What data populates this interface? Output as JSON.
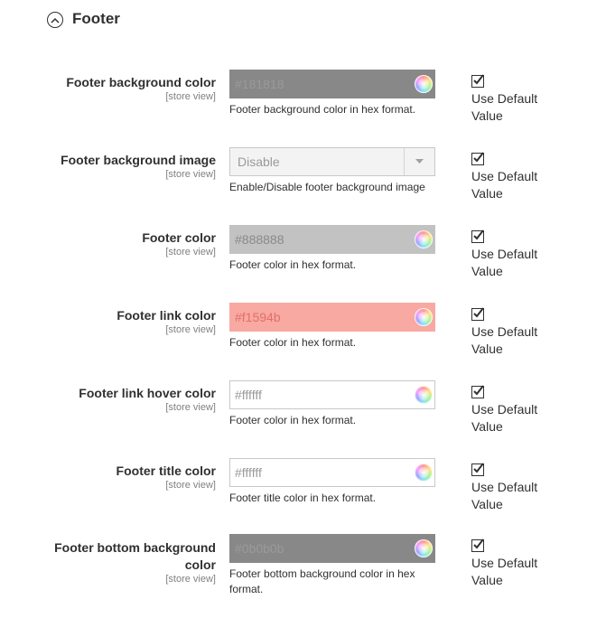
{
  "section": {
    "title": "Footer"
  },
  "fields": [
    {
      "label": "Footer background color",
      "scope": "[store view]",
      "value": "#181818",
      "note": "Footer background color in hex format.",
      "use_default": "Use Default Value",
      "bg": "#888888",
      "text_color": "#9a9a9a",
      "border": "#888888"
    },
    {
      "label": "Footer background image",
      "scope": "[store view]",
      "value": "Disable",
      "note": "Enable/Disable footer background image",
      "use_default": "Use Default Value"
    },
    {
      "label": "Footer color",
      "scope": "[store view]",
      "value": "#888888",
      "note": "Footer color in hex format.",
      "use_default": "Use Default Value",
      "bg": "#c2c2c2",
      "text_color": "#8a8a8a",
      "border": "#c2c2c2"
    },
    {
      "label": "Footer link color",
      "scope": "[store view]",
      "value": "#f1594b",
      "note": "Footer color in hex format.",
      "use_default": "Use Default Value",
      "bg": "#f8a9a2",
      "text_color": "#e27068",
      "border": "#f8a9a2"
    },
    {
      "label": "Footer link hover color",
      "scope": "[store view]",
      "value": "#ffffff",
      "note": "Footer color in hex format.",
      "use_default": "Use Default Value",
      "bg": "#ffffff",
      "text_color": "#9a9a9a",
      "border": "#c8c8c8"
    },
    {
      "label": "Footer title color",
      "scope": "[store view]",
      "value": "#ffffff",
      "note": "Footer title color in hex format.",
      "use_default": "Use Default Value",
      "bg": "#ffffff",
      "text_color": "#9a9a9a",
      "border": "#c8c8c8"
    },
    {
      "label": "Footer bottom background color",
      "scope": "[store view]",
      "value": "#0b0b0b",
      "note": "Footer bottom background color in hex format.",
      "use_default": "Use Default Value",
      "bg": "#888888",
      "text_color": "#9a9a9a",
      "border": "#888888"
    }
  ]
}
